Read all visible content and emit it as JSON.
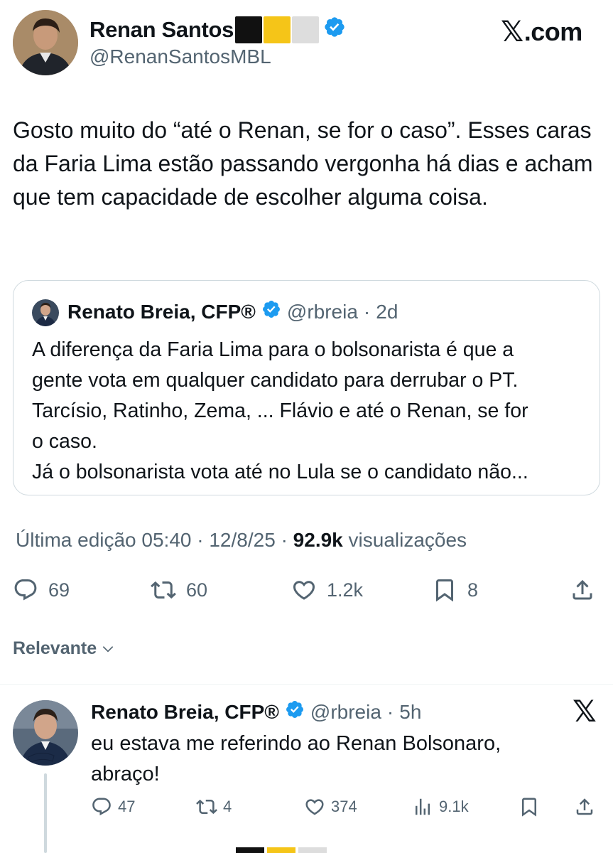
{
  "author": {
    "name": "Renan Santos",
    "handle": "@RenanSantosMBL",
    "flag_colors": [
      "#111111",
      "#f5c518",
      "#dddddd"
    ]
  },
  "brand": {
    "logo_glyph": "𝕏",
    "logo_text": ".com"
  },
  "tweet": {
    "text": "Gosto muito do “até o Renan, se for o caso”. Esses caras da Faria Lima estão passando vergonha há dias e acham que tem capacidade de escolher alguma coisa."
  },
  "quote": {
    "name": "Renato Breia, CFP®",
    "handle": "@rbreia",
    "separator": "·",
    "age": "2d",
    "text_lines": [
      "A diferença da Faria Lima para o bolsonarista é que a",
      "gente vota em qualquer candidato para derrubar o PT.",
      "Tarcísio, Ratinho, Zema, ... Flávio e até o Renan, se for",
      "o caso.",
      "Já o bolsonarista vota até no Lula se o candidato não..."
    ]
  },
  "meta": {
    "edited": "Última edição 05:40 · 12/8/25",
    "separator": "·",
    "views_count": "92.9k",
    "views_label": "visualizações"
  },
  "actions": {
    "replies": "69",
    "reposts": "60",
    "likes": "1.2k",
    "bookmarks": "8"
  },
  "sort": {
    "label": "Relevante"
  },
  "reply": {
    "name": "Renato Breia, CFP®",
    "handle": "@rbreia",
    "separator": "·",
    "age": "5h",
    "x_glyph": "𝕏",
    "text_lines": [
      "eu estava me referindo ao Renan Bolsonaro,",
      "abraço!"
    ],
    "replies": "47",
    "reposts": "4",
    "likes": "374",
    "views": "9.1k"
  },
  "colors": {
    "verified": "#1d9bf0",
    "text": "#0f1419",
    "muted": "#536471",
    "border": "#cfd9de"
  }
}
